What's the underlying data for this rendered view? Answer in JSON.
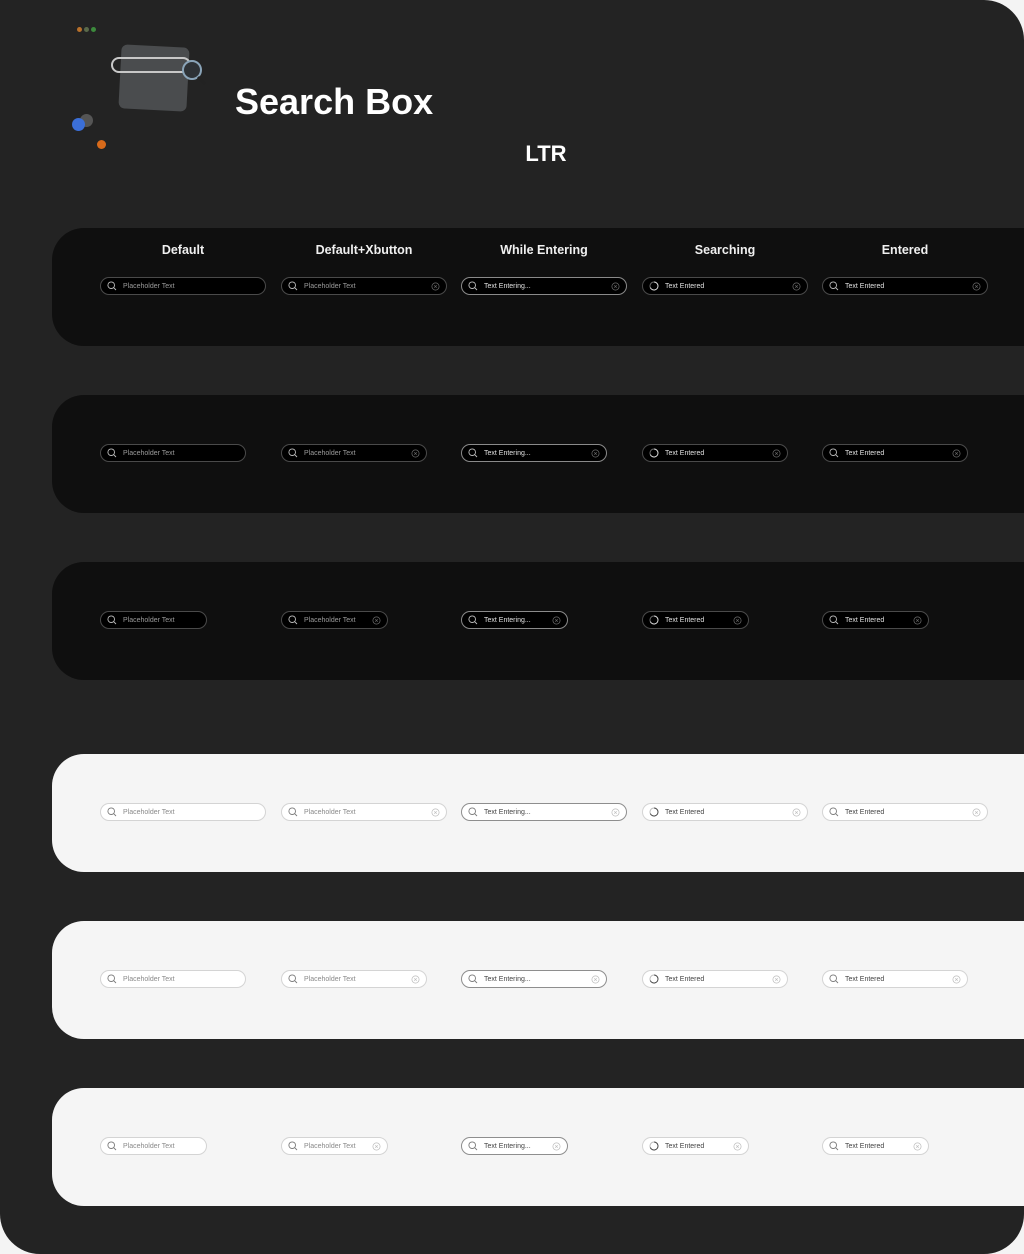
{
  "header": {
    "title": "Search Box",
    "subtitle": "LTR"
  },
  "columns": [
    {
      "label": "Default",
      "state": "default",
      "text": "Placeholder Text",
      "is_placeholder": true,
      "clear_button": false,
      "icon": "search-icon"
    },
    {
      "label": "Default+Xbutton",
      "state": "default-xbutton",
      "text": "Placeholder Text",
      "is_placeholder": true,
      "clear_button": true,
      "icon": "search-icon"
    },
    {
      "label": "While Entering",
      "state": "while-entering",
      "text": "Text Entering...",
      "is_placeholder": false,
      "clear_button": true,
      "icon": "search-icon"
    },
    {
      "label": "Searching",
      "state": "searching",
      "text": "Text Entered",
      "is_placeholder": false,
      "clear_button": true,
      "icon": "loading-spinner-icon"
    },
    {
      "label": "Entered",
      "state": "entered",
      "text": "Text Entered",
      "is_placeholder": false,
      "clear_button": true,
      "icon": "search-icon"
    }
  ],
  "rows": [
    {
      "theme": "dark",
      "size": "large"
    },
    {
      "theme": "dark",
      "size": "medium"
    },
    {
      "theme": "dark",
      "size": "small"
    },
    {
      "theme": "light",
      "size": "large"
    },
    {
      "theme": "light",
      "size": "medium"
    },
    {
      "theme": "light",
      "size": "small"
    }
  ],
  "colors": {
    "page_bg": "#232323",
    "dark_panel": "#0f0f0f",
    "light_panel": "#f5f5f5",
    "accent_blue": "#3b6fd8",
    "accent_orange": "#d86a1a",
    "accent_green": "#3c8a3c"
  }
}
